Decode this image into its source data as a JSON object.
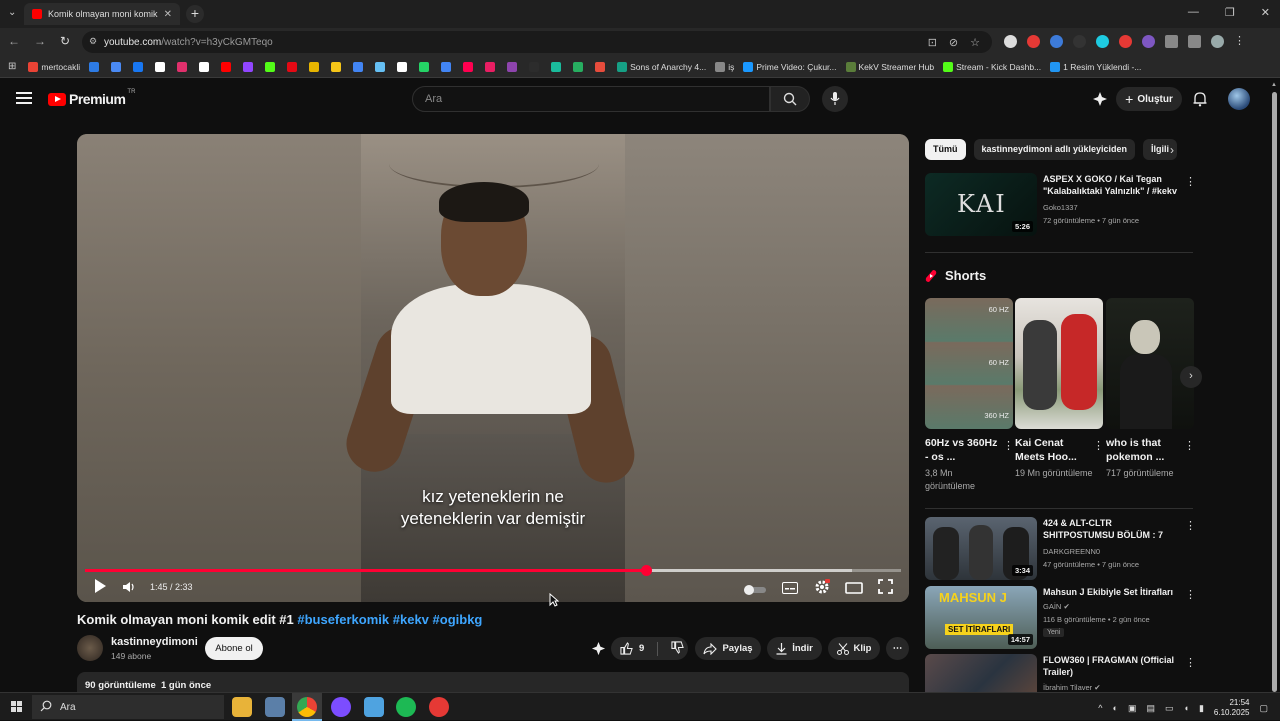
{
  "browser": {
    "tab_title": "Komik olmayan moni komik edi",
    "new_tab": "+",
    "url_main": "youtube.com",
    "url_rest": "/watch?v=h3yCkGMTeqo",
    "bookmarks": [
      {
        "label": "mertocakli",
        "color": "#ea4335"
      },
      {
        "label": "",
        "color": "#2d7be5"
      },
      {
        "label": "",
        "color": "#4a8af4"
      },
      {
        "label": "",
        "color": "#1877f2"
      },
      {
        "label": "",
        "color": "#ffffff"
      },
      {
        "label": "",
        "color": "#e1306c"
      },
      {
        "label": "",
        "color": "#ffffff"
      },
      {
        "label": "",
        "color": "#ff0000"
      },
      {
        "label": "",
        "color": "#9146ff"
      },
      {
        "label": "",
        "color": "#53fc18"
      },
      {
        "label": "",
        "color": "#e50914"
      },
      {
        "label": "",
        "color": "#e6b400"
      },
      {
        "label": "",
        "color": "#f5c518"
      },
      {
        "label": "",
        "color": "#4285f4"
      },
      {
        "label": "",
        "color": "#66c0f4"
      },
      {
        "label": "",
        "color": "#ffffff"
      },
      {
        "label": "",
        "color": "#25d366"
      },
      {
        "label": "",
        "color": "#4285f4"
      },
      {
        "label": "",
        "color": "#ff0050"
      },
      {
        "label": "",
        "color": "#e91e63"
      },
      {
        "label": "",
        "color": "#8e44ad"
      },
      {
        "label": "",
        "color": "#2c2c2c"
      },
      {
        "label": "",
        "color": "#1abc9c"
      },
      {
        "label": "",
        "color": "#27ae60"
      },
      {
        "label": "",
        "color": "#e74c3c"
      },
      {
        "label": "Sons of Anarchy 4...",
        "color": "#16a085"
      },
      {
        "label": "iş",
        "color": "#888888"
      },
      {
        "label": "Prime Video: Çukur...",
        "color": "#1a98ff"
      },
      {
        "label": "KekV Streamer Hub",
        "color": "#5a7d3a"
      },
      {
        "label": "Stream - Kick Dashb...",
        "color": "#53fc18"
      },
      {
        "label": "1 Resim Yüklendi -...",
        "color": "#2196f3"
      }
    ]
  },
  "youtube": {
    "logo_word": "Premium",
    "logo_region": "TR",
    "search_placeholder": "Ara",
    "create_label": "Oluştur",
    "video": {
      "caption_line1": "kız yeteneklerin ne",
      "caption_line2": "yeteneklerin var demiştir",
      "time": "1:45 / 2:33",
      "progress": 0.688,
      "buffered": 0.94,
      "title": "Komik olmayan moni komik edit #1",
      "hashtags": [
        "#buseferkomik",
        "#kekv",
        "#ogibkg"
      ],
      "channel": "kastinneydimoni",
      "subscribers": "149 abone",
      "subscribe_label": "Abone ol",
      "likes": "9",
      "share_label": "Paylaş",
      "download_label": "İndir",
      "clip_label": "Klip",
      "views_date": "90 görüntüleme  1 gün önce"
    },
    "chips": [
      "Tümü",
      "kastinneydimoni adlı yükleyiciden",
      "İlgili"
    ],
    "recommended_top": {
      "title": "ASPEX X GOKO / Kai Tegan \"Kalabalıktaki Yalnızlık\" / #kekv",
      "channel": "Goko1337",
      "meta": "72 görüntüleme • 7 gün önce",
      "duration": "5:26",
      "thumb_text": "KAI"
    },
    "shorts_heading": "Shorts",
    "shorts": [
      {
        "title": "60Hz vs 360Hz - os ...",
        "views": "3,8 Mn görüntüleme",
        "hz": [
          "60 HZ",
          "60 HZ",
          "360 HZ"
        ]
      },
      {
        "title": "Kai Cenat Meets Hoo...",
        "views": "19 Mn görüntüleme"
      },
      {
        "title": "who is that pokemon ...",
        "views": "717 görüntüleme"
      }
    ],
    "recommended": [
      {
        "title": "424 & ALT-CLTR SHITPOSTUMSU BÖLÜM : 7",
        "channel": "DARKGREENN0",
        "meta": "47 görüntüleme • 7 gün önce",
        "duration": "3:34",
        "badge": ""
      },
      {
        "title": "Mahsun J Ekibiyle Set İtirafları",
        "channel": "GAİN",
        "meta": "116 B görüntüleme • 2 gün önce",
        "duration": "14:57",
        "badge": "Yeni",
        "thumb_text": "MAHSUN J",
        "thumb_sub": "SET İTİRAFLARI"
      },
      {
        "title": "FLOW360 | FRAGMAN (Official Trailer)",
        "channel": "İbrahim Tilaver",
        "meta": "",
        "duration": "",
        "badge": ""
      }
    ]
  },
  "taskbar": {
    "search_label": "Ara",
    "time": "21:54",
    "date": "6.10.2025"
  }
}
